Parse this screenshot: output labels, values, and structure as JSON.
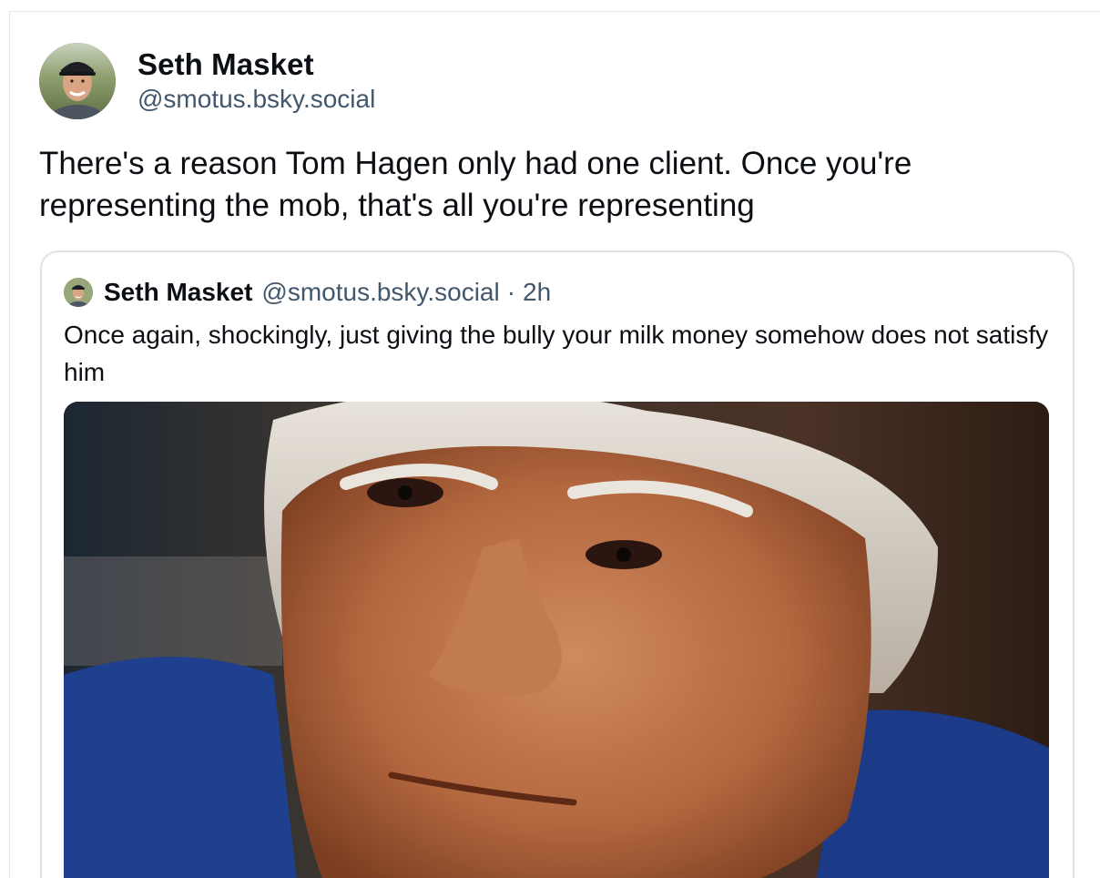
{
  "post": {
    "author_name": "Seth Masket",
    "author_handle": "@smotus.bsky.social",
    "text": "There's a reason Tom Hagen only had one client. Once you're representing the mob, that's all you're representing",
    "avatar_icon": "user-avatar-photo"
  },
  "quoted_post": {
    "author_name": "Seth Masket",
    "author_handle": "@smotus.bsky.social",
    "separator": "·",
    "time": "2h",
    "text": "Once again, shockingly, just giving the bully your milk money somehow does not satisfy him",
    "image_icon": "embedded-photo"
  },
  "colors": {
    "text_primary": "#0b0f14",
    "text_secondary": "#42576c",
    "border": "#dfe3e8"
  }
}
